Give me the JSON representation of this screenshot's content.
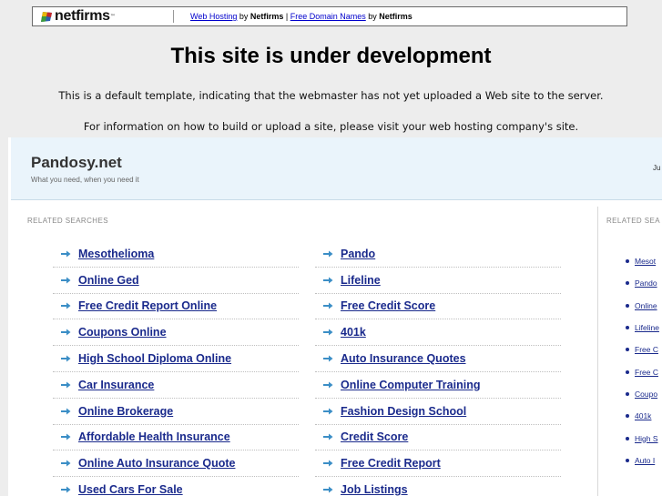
{
  "banner": {
    "logo_text": "netfirms",
    "logo_tm": "™",
    "link1": "Web Hosting",
    "by1": " by ",
    "brand1": "Netfirms",
    "sep": " | ",
    "link2": "Free Domain Names",
    "by2": " by ",
    "brand2": "Netfirms"
  },
  "headline": "This site is under development",
  "info_lines": [
    "This is a default template, indicating that the webmaster has not yet uploaded a Web site to the server.",
    "For information on how to build or upload a site, please visit your web hosting company's site."
  ],
  "parked": {
    "site_name": "Pandosy.net",
    "tagline": "What you need, when you need it",
    "header_right": "Ju",
    "related_title": "RELATED SEARCHES",
    "related_title_right": "RELATED SEA",
    "left_column": [
      "Mesothelioma",
      "Online Ged",
      "Free Credit Report Online",
      "Coupons Online",
      "High School Diploma Online",
      "Car Insurance",
      "Online Brokerage",
      "Affordable Health Insurance",
      "Online Auto Insurance Quote",
      "Used Cars For Sale"
    ],
    "right_column": [
      "Pando",
      "Lifeline",
      "Free Credit Score",
      "401k",
      "Auto Insurance Quotes",
      "Online Computer Training",
      "Fashion Design School",
      "Credit Score",
      "Free Credit Report",
      "Job Listings"
    ],
    "side_list": [
      "Mesot",
      "Pando",
      "Online",
      "Lifeline",
      "Free C",
      "Free C",
      "Coupo",
      "401k",
      "High S",
      "Auto I"
    ]
  },
  "colors": {
    "background": "#ededed",
    "link": "#1a2a8c",
    "arrow": "#3b8ec6",
    "header_band": "#eaf4fb"
  }
}
